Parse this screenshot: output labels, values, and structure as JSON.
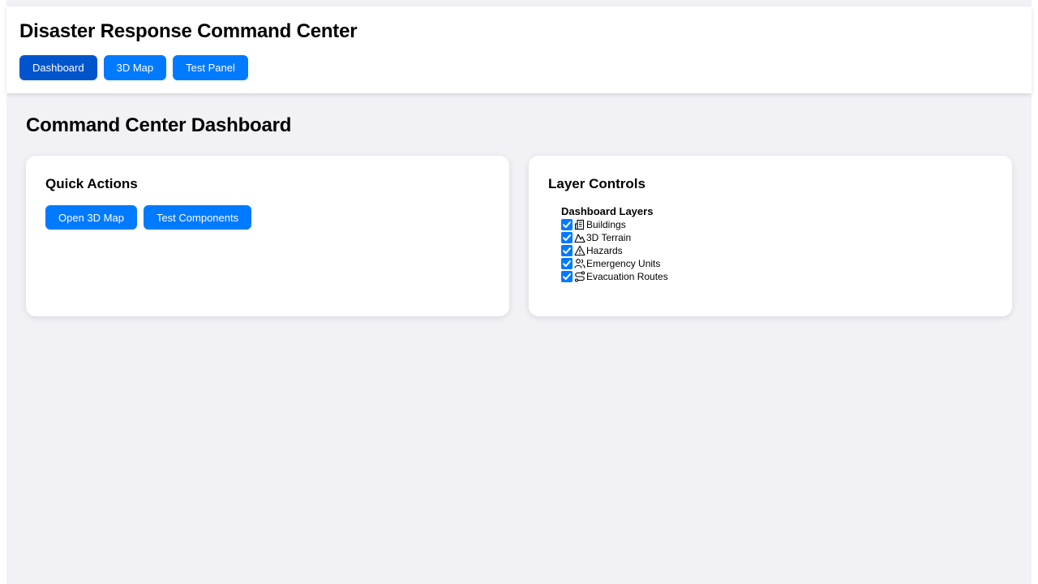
{
  "app": {
    "title": "Disaster Response Command Center"
  },
  "nav": {
    "items": [
      {
        "label": "Dashboard",
        "active": true
      },
      {
        "label": "3D Map",
        "active": false
      },
      {
        "label": "Test Panel",
        "active": false
      }
    ]
  },
  "page": {
    "title": "Command Center Dashboard"
  },
  "quick_actions": {
    "title": "Quick Actions",
    "buttons": [
      "Open 3D Map",
      "Test Components"
    ]
  },
  "layer_controls": {
    "title": "Layer Controls",
    "group_title": "Dashboard Layers",
    "layers": [
      {
        "label": "Buildings",
        "icon": "building-icon",
        "checked": true
      },
      {
        "label": "3D Terrain",
        "icon": "mountain-icon",
        "checked": true
      },
      {
        "label": "Hazards",
        "icon": "warning-triangle-icon",
        "checked": true
      },
      {
        "label": "Emergency Units",
        "icon": "users-icon",
        "checked": true
      },
      {
        "label": "Evacuation Routes",
        "icon": "route-icon",
        "checked": true
      }
    ]
  },
  "colors": {
    "accent": "#007aff",
    "accent_active": "#0055cc",
    "background": "#f1f1f6",
    "card": "#ffffff"
  }
}
